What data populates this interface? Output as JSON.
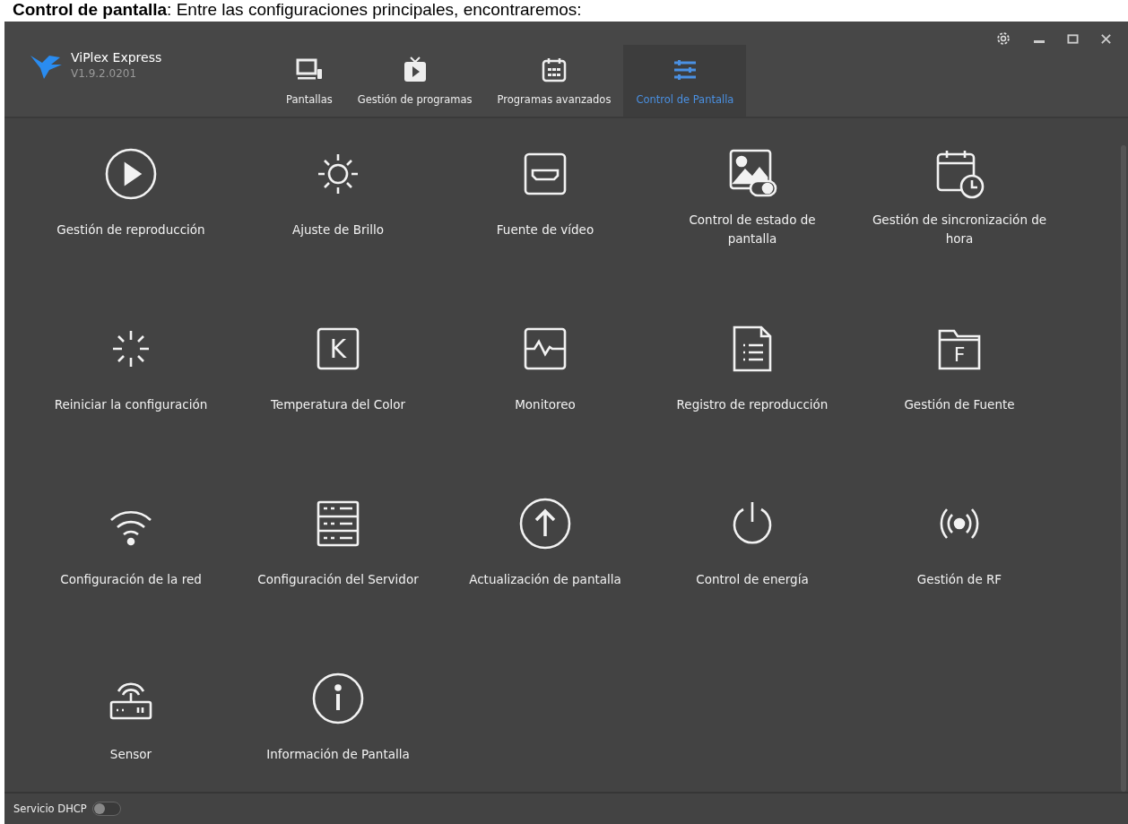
{
  "caption": "**Control de pantalla**: Entre las configuraciones principales, encontraremos:",
  "app": {
    "name": "ViPlex Express",
    "version": "V1.9.2.0201"
  },
  "tabs": [
    {
      "label": "Pantallas",
      "selected": false
    },
    {
      "label": "Gestión de programas",
      "selected": false
    },
    {
      "label": "Programas avanzados",
      "selected": false
    },
    {
      "label": "Control de Pantalla",
      "selected": true
    }
  ],
  "functions": [
    {
      "label": "Gestión de reproducción"
    },
    {
      "label": "Ajuste de Brillo"
    },
    {
      "label": "Fuente de vídeo"
    },
    {
      "label": "Control de estado de pantalla"
    },
    {
      "label": "Gestión de sincronización de hora"
    },
    {
      "label": "Reiniciar la configuración"
    },
    {
      "label": "Temperatura del Color"
    },
    {
      "label": "Monitoreo"
    },
    {
      "label": "Registro de reproducción"
    },
    {
      "label": "Gestión de Fuente"
    },
    {
      "label": "Configuración de la red"
    },
    {
      "label": "Configuración del Servidor"
    },
    {
      "label": "Actualización de pantalla"
    },
    {
      "label": "Control de energía"
    },
    {
      "label": "Gestión de RF"
    },
    {
      "label": "Sensor"
    },
    {
      "label": "Información de Pantalla"
    }
  ],
  "icon_letters": {
    "temperature": "K",
    "font": "F"
  },
  "footer": {
    "dhcp_label": "Servicio DHCP",
    "dhcp_on": false
  }
}
